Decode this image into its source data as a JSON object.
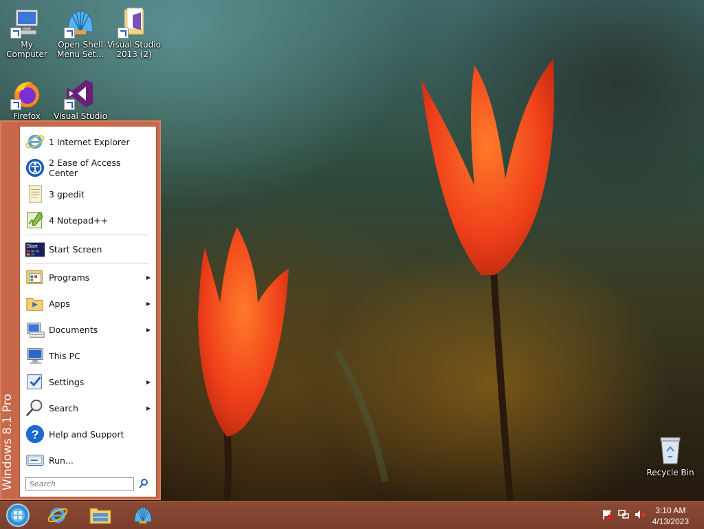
{
  "desktop_icons": [
    {
      "label": "My Computer",
      "icon": "computer-icon"
    },
    {
      "label": "Open-Shell Menu Set...",
      "icon": "shell-icon"
    },
    {
      "label": "Visual Studio 2013 (2)",
      "icon": "folder-icon"
    },
    {
      "label": "Firefox",
      "icon": "firefox-icon"
    },
    {
      "label": "Visual Studio",
      "icon": "visual-studio-icon"
    },
    {
      "label": "Recycle Bin",
      "icon": "recycle-bin-icon"
    }
  ],
  "start_menu": {
    "edition_band": "Windows 8.1 Pro",
    "recent": [
      {
        "label": "1 Internet Explorer",
        "icon": "internet-explorer-icon"
      },
      {
        "label": "2 Ease of Access Center",
        "icon": "ease-of-access-icon"
      },
      {
        "label": "3 gpedit",
        "icon": "document-icon"
      },
      {
        "label": "4 Notepad++",
        "icon": "notepad-plus-plus-icon"
      }
    ],
    "start_screen": {
      "label": "Start Screen",
      "icon": "start-screen-icon",
      "tile_text": "Start"
    },
    "items": [
      {
        "label": "Programs",
        "icon": "programs-icon",
        "submenu": true
      },
      {
        "label": "Apps",
        "icon": "apps-folder-icon",
        "submenu": true
      },
      {
        "label": "Documents",
        "icon": "documents-icon",
        "submenu": true
      },
      {
        "label": "This PC",
        "icon": "this-pc-icon",
        "submenu": false
      },
      {
        "label": "Settings",
        "icon": "settings-icon",
        "submenu": true
      },
      {
        "label": "Search",
        "icon": "search-icon",
        "submenu": true
      },
      {
        "label": "Help and Support",
        "icon": "help-icon",
        "submenu": false
      },
      {
        "label": "Run...",
        "icon": "run-icon",
        "submenu": false
      }
    ],
    "search_placeholder": "Search"
  },
  "taskbar": {
    "pinned": [
      {
        "name": "start-orb",
        "icon": "windows-orb-icon"
      },
      {
        "name": "internet-explorer",
        "icon": "internet-explorer-icon"
      },
      {
        "name": "file-explorer",
        "icon": "file-explorer-icon"
      },
      {
        "name": "open-shell",
        "icon": "shell-icon"
      }
    ],
    "tray": {
      "icons": [
        "action-center-flag-icon",
        "network-icon",
        "speaker-muted-icon"
      ],
      "time": "3:10 AM",
      "date": "4/13/2023"
    }
  },
  "colors": {
    "menu_frame": "#c8684a",
    "taskbar": "#7a3e2c",
    "accent_blue": "#1a5fc9"
  }
}
